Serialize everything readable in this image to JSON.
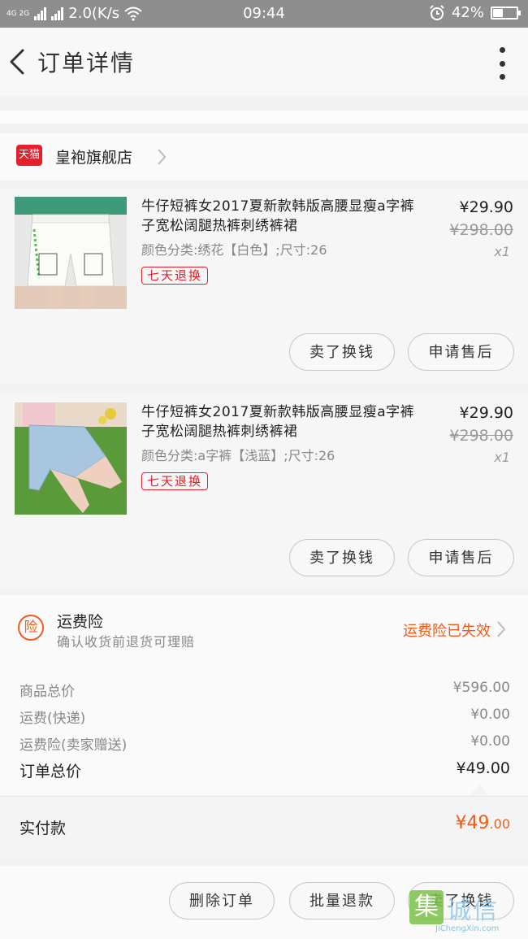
{
  "statusbar": {
    "network_label": "4G 2G",
    "speed": "2.0(K/s",
    "time": "09:44",
    "battery": "42%",
    "battery_level": 0.42
  },
  "navbar": {
    "title": "订单详情"
  },
  "shop": {
    "badge": "天猫",
    "name": "皇袍旗舰店"
  },
  "items": [
    {
      "title": "牛仔短裤女2017夏新款韩版高腰显瘦a字裤子宽松阔腿热裤刺绣裤裙",
      "sku": "颜色分类:绣花【白色】;尺寸:26",
      "tag": "七天退换",
      "price": "¥29.90",
      "original_price": "¥298.00",
      "qty": "x1",
      "buttons": {
        "sell": "卖了换钱",
        "after_sale": "申请售后"
      }
    },
    {
      "title": "牛仔短裤女2017夏新款韩版高腰显瘦a字裤子宽松阔腿热裤刺绣裤裙",
      "sku": "颜色分类:a字裤【浅蓝】;尺寸:26",
      "tag": "七天退换",
      "price": "¥29.90",
      "original_price": "¥298.00",
      "qty": "x1",
      "buttons": {
        "sell": "卖了换钱",
        "after_sale": "申请售后"
      }
    }
  ],
  "insurance": {
    "icon_char": "险",
    "name": "运费险",
    "desc": "确认收货前退货可理赔",
    "status": "运费险已失效"
  },
  "summary": {
    "goods_label": "商品总价",
    "goods_value": "¥596.00",
    "shipping_label": "运费(快递)",
    "shipping_value": "¥0.00",
    "ins_label": "运费险(卖家赠送)",
    "ins_value": "¥0.00",
    "total_label": "订单总价",
    "total_value": "¥49.00"
  },
  "paid": {
    "label": "实付款",
    "value_main": "¥49",
    "value_decimal": ".00"
  },
  "actions": {
    "delete": "删除订单",
    "batch_refund": "批量退款",
    "sell": "卖了换钱"
  },
  "watermark": {
    "glyph": "集",
    "text": "诚信",
    "site": "JiChengXin.com"
  },
  "colors": {
    "accent": "#f25c1a",
    "tmall_red": "#e5202a",
    "statusbar": "#8e8e8e"
  }
}
